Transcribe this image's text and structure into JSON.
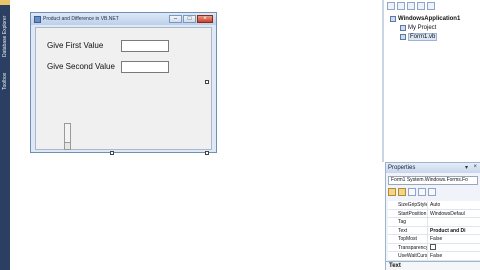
{
  "left_strip": {
    "tabs": [
      "Database Explorer",
      "Toolbox"
    ]
  },
  "form": {
    "title": "Product and Difference in VB.NET",
    "label_first": "Give First Value",
    "label_second": "Give Second Value",
    "first_value": "",
    "second_value": ""
  },
  "solution_explorer": {
    "items": [
      {
        "label": "WindowsApplication1"
      },
      {
        "label": "My Project"
      },
      {
        "label": "Form1.vb"
      }
    ]
  },
  "properties": {
    "header": "Properties",
    "object": "Form1 System.Windows.Forms.Fo",
    "rows": [
      {
        "key": "SizeGripStyle",
        "value": "Auto"
      },
      {
        "key": "StartPosition",
        "value": "WindowsDefaul"
      },
      {
        "key": "Tag",
        "value": ""
      },
      {
        "key": "Text",
        "value": "Product and Di"
      },
      {
        "key": "TopMost",
        "value": "False"
      },
      {
        "key": "Transparency",
        "value": ""
      },
      {
        "key": "UseWaitCursor",
        "value": "False"
      }
    ],
    "footer": "Text"
  }
}
